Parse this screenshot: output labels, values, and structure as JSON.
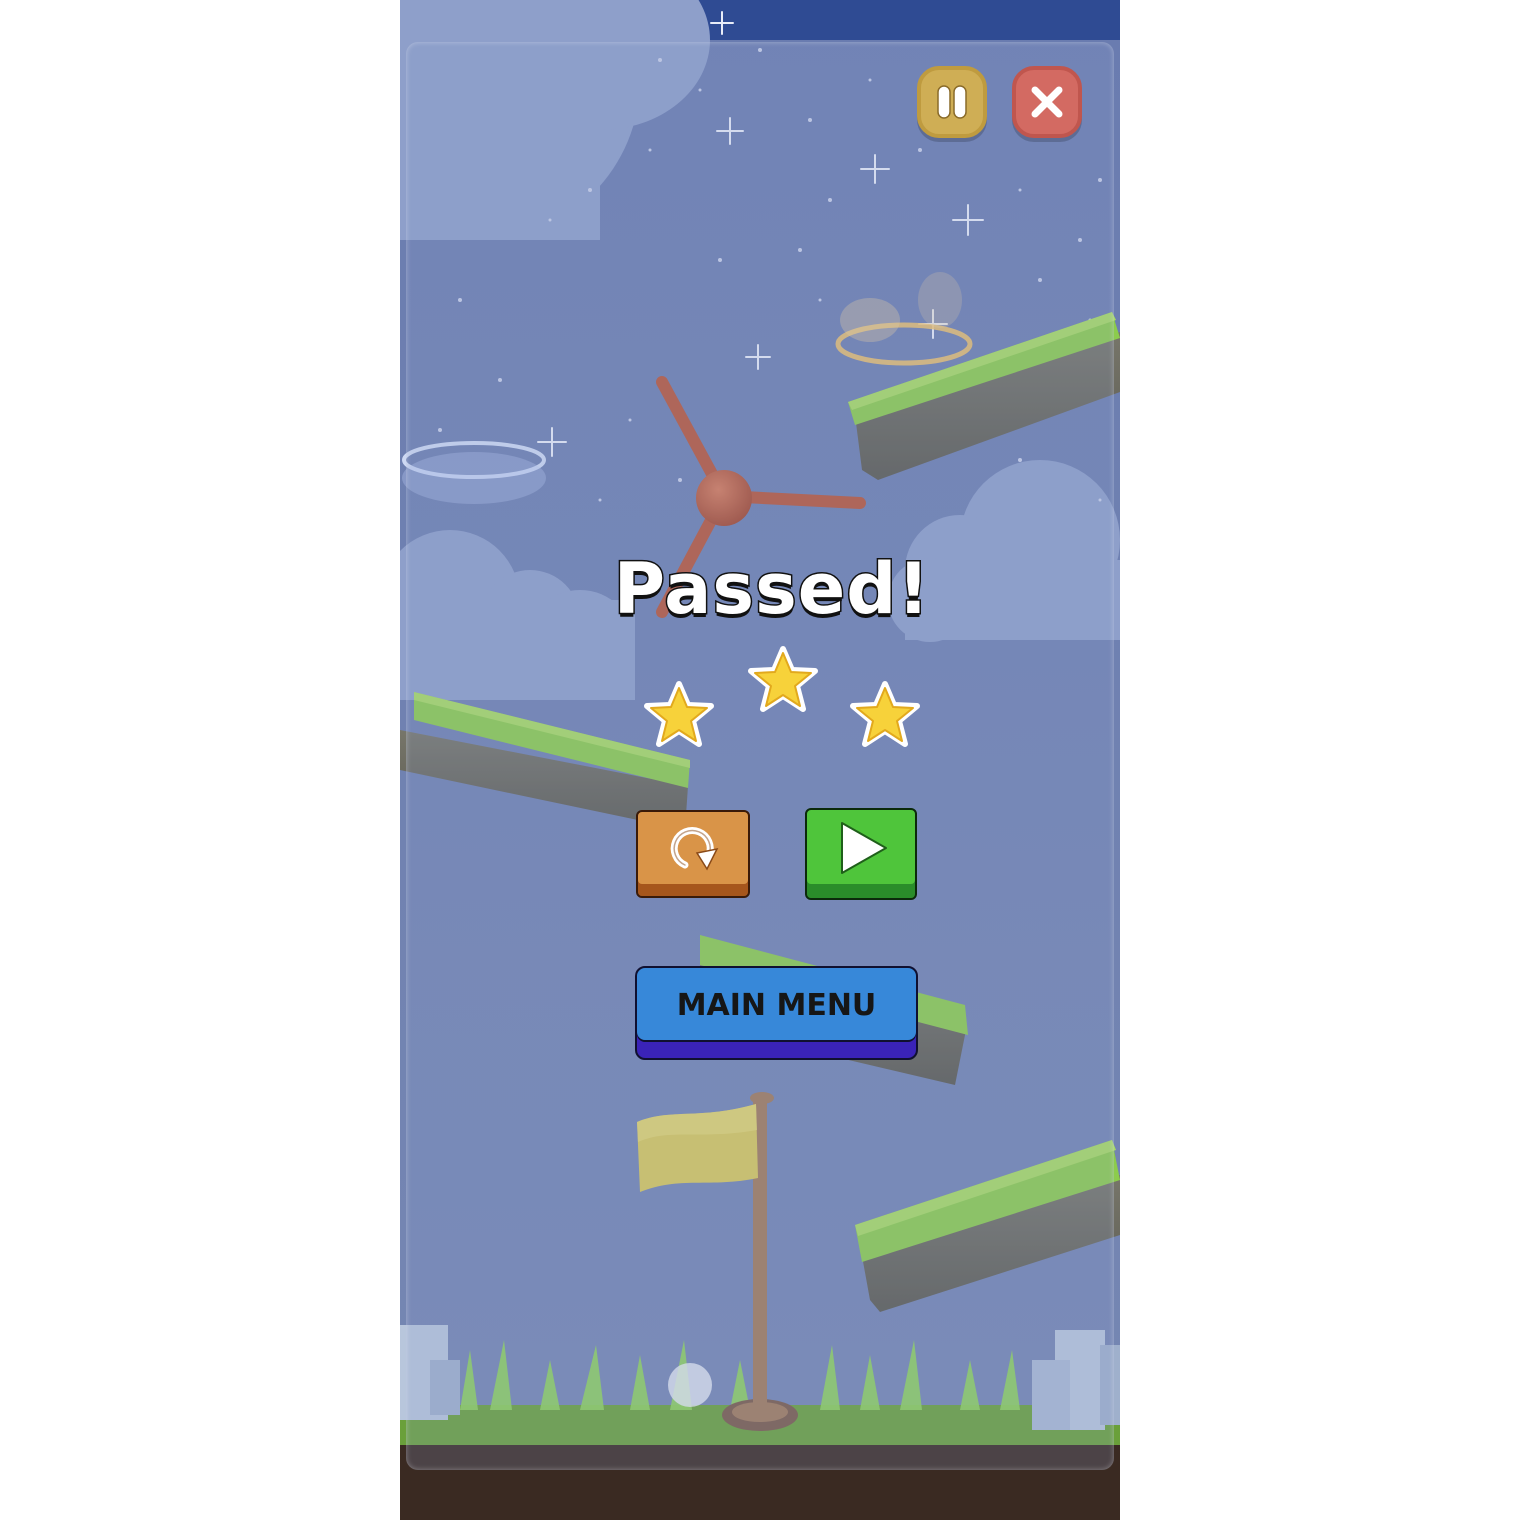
{
  "screen": {
    "title": "Passed!",
    "stars_earned": 3,
    "stars_total": 3
  },
  "controls": {
    "pause": {
      "icon": "pause-icon"
    },
    "close": {
      "icon": "close-icon"
    },
    "replay": {
      "icon": "replay-icon"
    },
    "next": {
      "icon": "play-icon"
    },
    "main_menu_label": "MAIN MENU"
  },
  "colors": {
    "sky": "#7083b0",
    "grass": "#8ccc4c",
    "stone": "#6b6a5e",
    "replay_button": "#d99448",
    "next_button": "#4fc53b",
    "menu_button": "#3788d9",
    "pause_button": "#cfae55",
    "close_button": "#d36a62",
    "star": "#f7d23a",
    "flag": "#d8c85a",
    "pole": "#a07a5a",
    "windmill": "#b8573a"
  }
}
